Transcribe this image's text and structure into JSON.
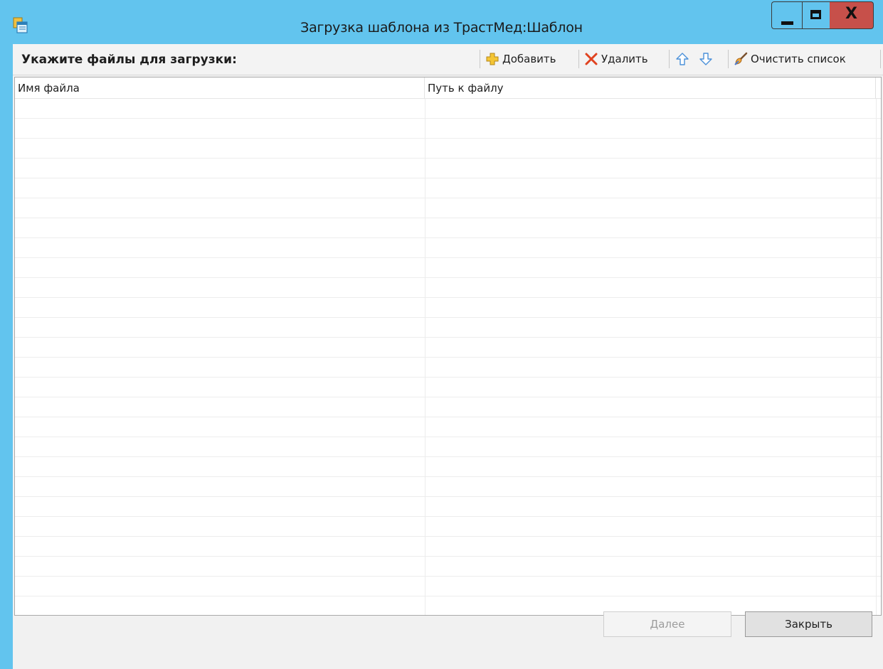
{
  "window": {
    "title": "Загрузка шаблона из ТрастМед:Шаблон",
    "close_glyph": "X",
    "icons": {
      "app": "app-window-icon",
      "minimize": "minimize-icon",
      "maximize": "maximize-icon",
      "close": "close-icon"
    },
    "colors": {
      "frame": "#62c4ee",
      "close_button": "#c7504a"
    }
  },
  "toolbar": {
    "label": "Укажите файлы для загрузки:",
    "add_label": "Добавить",
    "delete_label": "Удалить",
    "clear_label": "Очистить список",
    "icons": {
      "add": "add-plus-icon",
      "delete": "delete-x-icon",
      "move_up": "arrow-up-icon",
      "move_down": "arrow-down-icon",
      "clear": "clear-brush-icon"
    }
  },
  "grid": {
    "columns": [
      "Имя файла",
      "Путь к файлу"
    ],
    "rows": []
  },
  "footer": {
    "next_label": "Далее",
    "close_label": "Закрыть"
  }
}
